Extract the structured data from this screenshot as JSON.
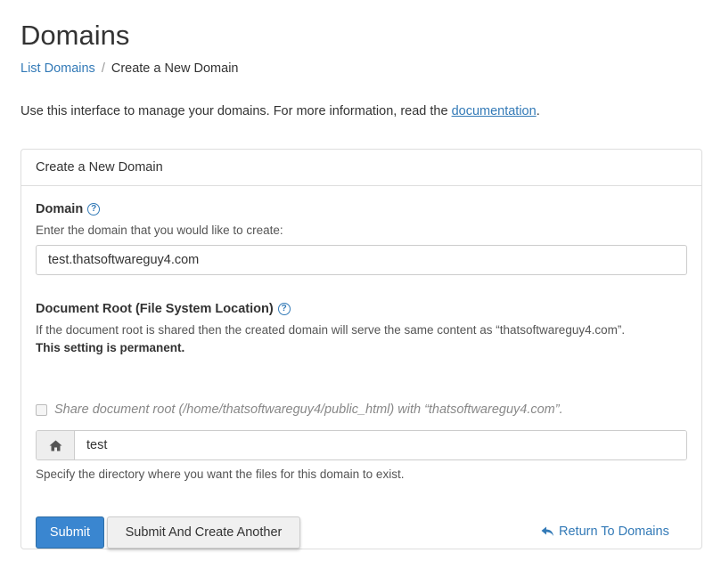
{
  "header": {
    "title": "Domains",
    "breadcrumb": {
      "link": "List Domains",
      "separator": "/",
      "current": "Create a New Domain"
    },
    "intro_text": "Use this interface to manage your domains. For more information, read the ",
    "intro_link": "documentation",
    "intro_end": "."
  },
  "panel": {
    "heading": "Create a New Domain",
    "domain": {
      "label": "Domain",
      "hint": "Enter the domain that you would like to create:",
      "value": "test.thatsoftwareguy4.com"
    },
    "docroot": {
      "label": "Document Root (File System Location)",
      "hint": "If the document root is shared then the created domain will serve the same content as “thatsoftwareguy4.com”.",
      "permanent_note": "This setting is permanent.",
      "share_checkbox_label": "Share document root (/home/thatsoftwareguy4/public_html) with “thatsoftwareguy4.com”.",
      "share_checked": false,
      "value": "test",
      "specify_hint": "Specify the directory where you want the files for this domain to exist."
    },
    "actions": {
      "submit": "Submit",
      "submit_another": "Submit And Create Another",
      "return": "Return To Domains"
    }
  },
  "colors": {
    "link": "#337ab7",
    "primary_button": "#3a86d0"
  },
  "icons": {
    "help": "question-circle-icon",
    "home": "home-icon",
    "return": "reply-arrow-icon"
  }
}
